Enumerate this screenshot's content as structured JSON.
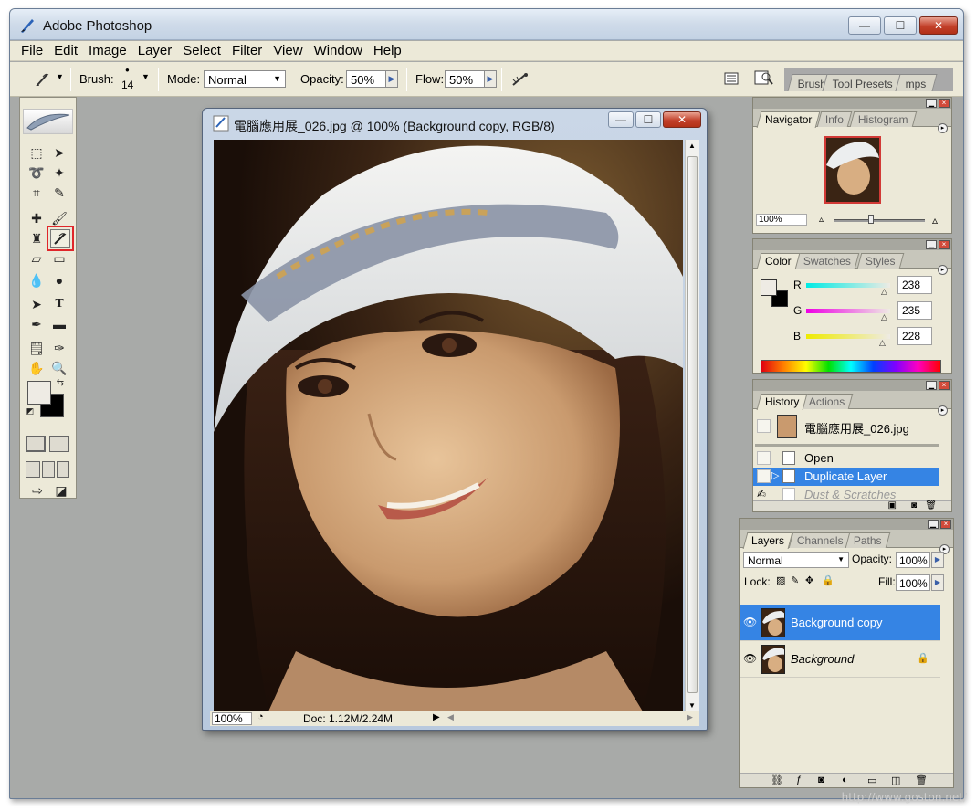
{
  "window": {
    "title": "Adobe Photoshop",
    "min": "—",
    "max": "☐",
    "close": "✕"
  },
  "menu": [
    "File",
    "Edit",
    "Image",
    "Layer",
    "Select",
    "Filter",
    "View",
    "Window",
    "Help"
  ],
  "options": {
    "brush_label": "Brush:",
    "brush_size": "14",
    "mode_label": "Mode:",
    "mode_value": "Normal",
    "opacity_label": "Opacity:",
    "opacity_value": "50%",
    "flow_label": "Flow:",
    "flow_value": "50%"
  },
  "well_tabs": [
    "Brush",
    "Tool Presets",
    "mps"
  ],
  "document": {
    "title": "電腦應用展_026.jpg @ 100% (Background copy, RGB/8)",
    "zoom": "100%",
    "doc_size": "Doc: 1.12M/2.24M"
  },
  "navigator": {
    "tabs": [
      "Navigator",
      "Info",
      "Histogram"
    ],
    "zoom": "100%"
  },
  "color": {
    "tabs": [
      "Color",
      "Swatches",
      "Styles"
    ],
    "r_label": "R",
    "r": "238",
    "g_label": "G",
    "g": "235",
    "b_label": "B",
    "b": "228",
    "foreground": "#eeebe4",
    "background": "#000000"
  },
  "history": {
    "tabs": [
      "History",
      "Actions"
    ],
    "snapshot": "電腦應用展_026.jpg",
    "items": [
      "Open",
      "Duplicate Layer",
      "Dust & Scratches"
    ]
  },
  "layers": {
    "tabs": [
      "Layers",
      "Channels",
      "Paths"
    ],
    "blend": "Normal",
    "opacity_label": "Opacity:",
    "opacity": "100%",
    "lock_label": "Lock:",
    "fill_label": "Fill:",
    "fill": "100%",
    "items": [
      "Background copy",
      "Background"
    ]
  },
  "watermark": "http://www.goston.net/",
  "accent": "#3584e4",
  "highlight_color": "#e0262a",
  "highlighted_tool": "history-brush-icon"
}
